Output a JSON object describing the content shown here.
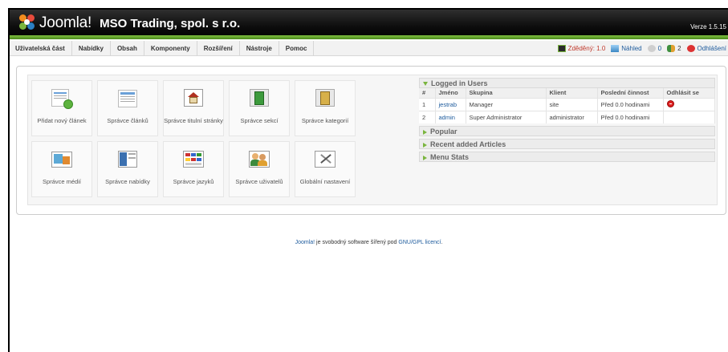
{
  "header": {
    "logo_text": "Joomla!",
    "site_title": "MSO Trading, spol. s r.o.",
    "version": "Verze 1.5.15"
  },
  "menu": [
    {
      "label": "Uživatelská část"
    },
    {
      "label": "Nabídky"
    },
    {
      "label": "Obsah"
    },
    {
      "label": "Komponenty"
    },
    {
      "label": "Rozšíření"
    },
    {
      "label": "Nástroje"
    },
    {
      "label": "Pomoc"
    }
  ],
  "status": {
    "sent": "Zděděný: 1.0",
    "preview": "Náhled",
    "messages": "0",
    "users": "2",
    "logout": "Odhlášení"
  },
  "cpanel": [
    {
      "label": "Přidat nový článek",
      "icon": "add-article-icon"
    },
    {
      "label": "Správce článků",
      "icon": "article-manager-icon"
    },
    {
      "label": "Správce titulní stránky",
      "icon": "frontpage-manager-icon"
    },
    {
      "label": "Správce sekcí",
      "icon": "section-manager-icon"
    },
    {
      "label": "Správce kategorií",
      "icon": "category-manager-icon"
    },
    {
      "label": "Správce médií",
      "icon": "media-manager-icon"
    },
    {
      "label": "Správce nabídky",
      "icon": "menu-manager-icon"
    },
    {
      "label": "Správce jazyků",
      "icon": "language-manager-icon"
    },
    {
      "label": "Správce uživatelů",
      "icon": "user-manager-icon"
    },
    {
      "label": "Globální nastavení",
      "icon": "global-config-icon"
    }
  ],
  "logged_users": {
    "title": "Logged in Users",
    "columns": [
      "#",
      "Jméno",
      "Skupina",
      "Klient",
      "Poslední činnost",
      "Odhlásit se"
    ],
    "rows": [
      {
        "num": "1",
        "name": "jestrab",
        "group": "Manager",
        "client": "site",
        "last": "Před 0.0 hodinami",
        "logout": true
      },
      {
        "num": "2",
        "name": "admin",
        "group": "Super Administrator",
        "client": "administrator",
        "last": "Před 0.0 hodinami",
        "logout": false
      }
    ]
  },
  "collapsed_modules": [
    {
      "title": "Popular"
    },
    {
      "title": "Recent added Articles"
    },
    {
      "title": "Menu Stats"
    }
  ],
  "footer": {
    "link1": "Joomla!",
    "text": " je svobodný software šířený pod ",
    "link2": "GNU/GPL licencí",
    "end": "."
  },
  "colors": {
    "accent_green": "#7ab53e",
    "link_blue": "#1c5a9c",
    "header_bg": "#000000"
  }
}
